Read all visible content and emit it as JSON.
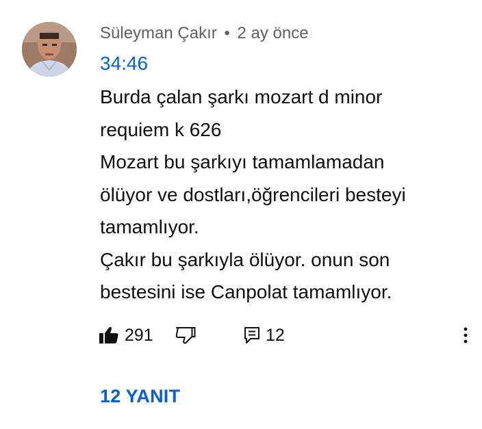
{
  "comment": {
    "author": "Süleyman Çakır",
    "separator": "•",
    "posted": "2 ay önce",
    "timestamp": "34:46",
    "lines": [
      "Burda çalan şarkı mozart d minor",
      "requiem k 626",
      "Mozart bu şarkıyı tamamlamadan",
      "ölüyor ve dostları,öğrencileri besteyi",
      "tamamlıyor.",
      "Çakır bu şarkıyla ölüyor. onun son",
      "bestesini ise Canpolat tamamlıyor."
    ],
    "likes": "291",
    "reply_count": "12",
    "replies_label": "12 YANIT",
    "icons": {
      "like": "thumb-up-icon",
      "dislike": "thumb-down-icon",
      "reply": "reply-icon",
      "more": "more-vert-icon"
    },
    "colors": {
      "link": "#065fd4",
      "meta": "#606060",
      "text": "#0f0f0f"
    }
  }
}
